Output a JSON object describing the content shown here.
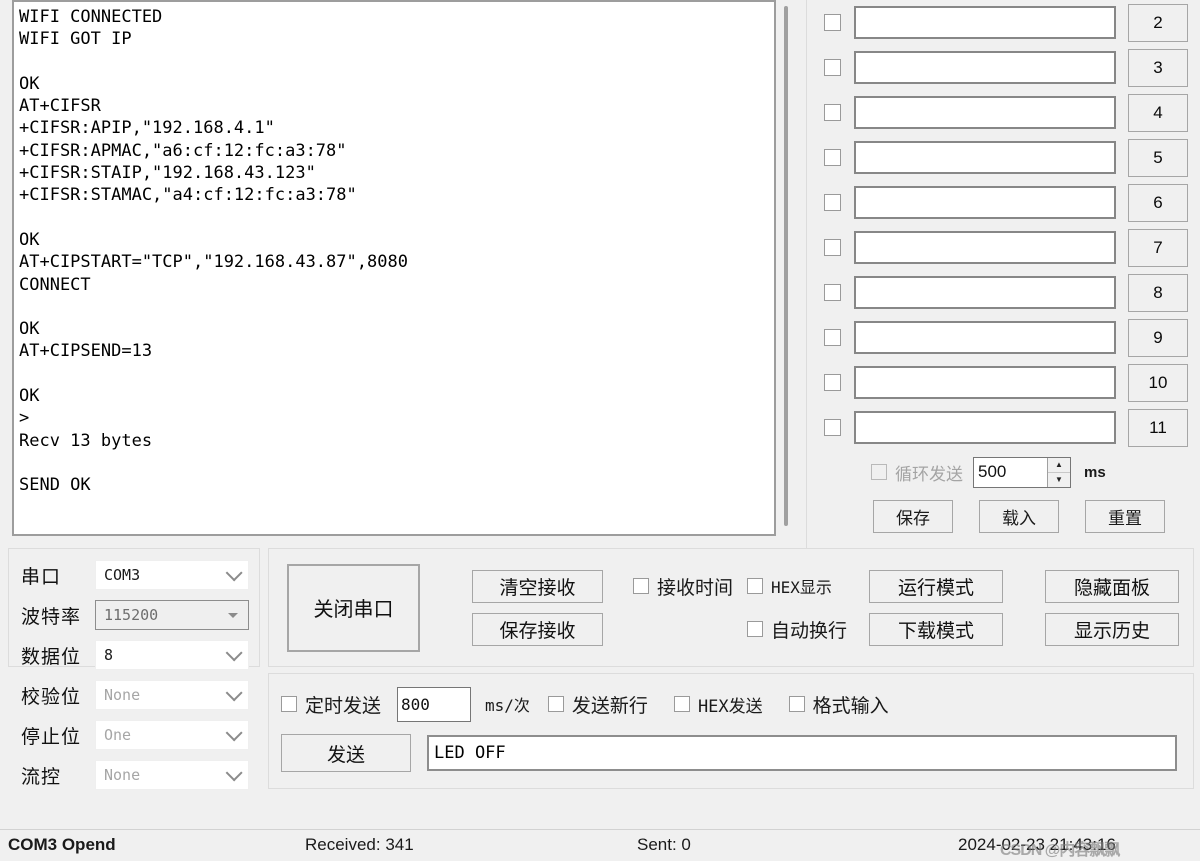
{
  "receive_panel": {
    "text": "WIFI CONNECTED\nWIFI GOT IP\n\nOK\nAT+CIFSR\n+CIFSR:APIP,\"192.168.4.1\"\n+CIFSR:APMAC,\"a6:cf:12:fc:a3:78\"\n+CIFSR:STAIP,\"192.168.43.123\"\n+CIFSR:STAMAC,\"a4:cf:12:fc:a3:78\"\n\nOK\nAT+CIPSTART=\"TCP\",\"192.168.43.87\",8080\nCONNECT\n\nOK\nAT+CIPSEND=13\n\nOK\n>\nRecv 13 bytes\n\nSEND OK\n"
  },
  "quick_send": {
    "rows": [
      {
        "index": "2",
        "value": "",
        "checked": false
      },
      {
        "index": "3",
        "value": "",
        "checked": false
      },
      {
        "index": "4",
        "value": "",
        "checked": false
      },
      {
        "index": "5",
        "value": "",
        "checked": false
      },
      {
        "index": "6",
        "value": "",
        "checked": false
      },
      {
        "index": "7",
        "value": "",
        "checked": false
      },
      {
        "index": "8",
        "value": "",
        "checked": false
      },
      {
        "index": "9",
        "value": "",
        "checked": false
      },
      {
        "index": "10",
        "value": "",
        "checked": false
      },
      {
        "index": "11",
        "value": "",
        "checked": false
      }
    ],
    "loop_send_label": "循环发送",
    "loop_interval": "500",
    "loop_unit": "ms",
    "save_label": "保存",
    "load_label": "载入",
    "reset_label": "重置"
  },
  "serial_settings": {
    "port": {
      "label": "串口",
      "value": "COM3"
    },
    "baud": {
      "label": "波特率",
      "value": "115200"
    },
    "databits": {
      "label": "数据位",
      "value": "8"
    },
    "parity": {
      "label": "校验位",
      "value": "None"
    },
    "stopbits": {
      "label": "停止位",
      "value": "One"
    },
    "flow": {
      "label": "流控",
      "value": "None"
    }
  },
  "controls": {
    "close_port": "关闭串口",
    "clear_receive": "清空接收",
    "save_receive": "保存接收",
    "recv_time": "接收时间",
    "hex_display": "HEX显示",
    "auto_wrap": "自动换行",
    "run_mode": "运行模式",
    "download_mode": "下载模式",
    "hide_panel": "隐藏面板",
    "show_history": "显示历史"
  },
  "send_panel": {
    "timed_send": "定时发送",
    "interval": "800",
    "interval_unit": "ms/次",
    "send_newline": "发送新行",
    "hex_send": "HEX发送",
    "format_input": "格式输入",
    "send_button": "发送",
    "send_value": "LED OFF"
  },
  "status_bar": {
    "connection": "COM3 Opend",
    "received": "Received: 341",
    "sent": "Sent: 0",
    "timestamp": "2024-02-23 21:43:16",
    "watermark": "CSDN @内容飘飘"
  },
  "colors": {
    "window_bg": "#f0f0f0",
    "field_bg": "#ffffff",
    "border": "#a6a6a6",
    "disabled_text": "#a4a4a4"
  }
}
